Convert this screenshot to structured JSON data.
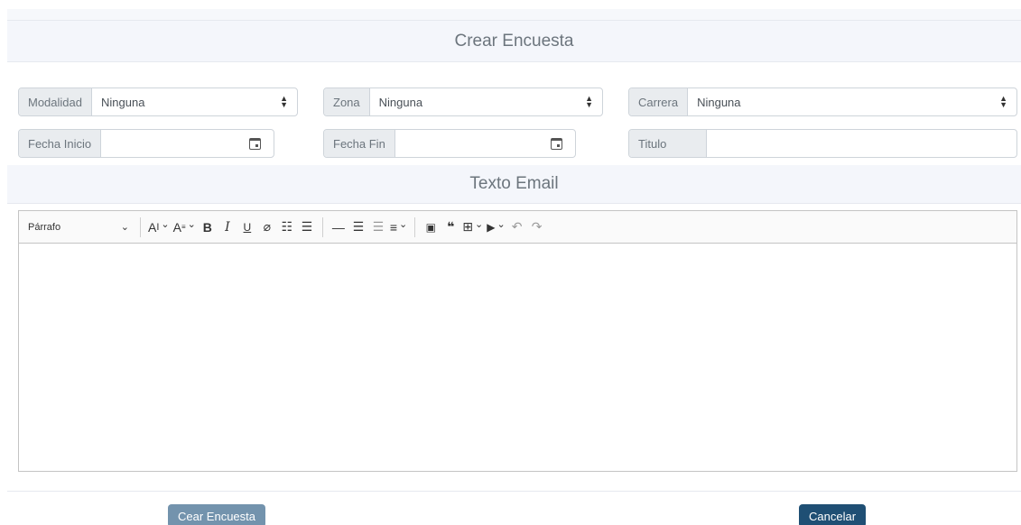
{
  "form": {
    "title": "Crear Encuesta",
    "email_title": "Texto Email",
    "filters": {
      "modalidad": {
        "label": "Modalidad",
        "value": "Ninguna"
      },
      "zona": {
        "label": "Zona",
        "value": "Ninguna"
      },
      "carrera": {
        "label": "Carrera",
        "value": "Ninguna"
      }
    },
    "dates": {
      "inicio": {
        "label": "Fecha Inicio",
        "value": ""
      },
      "fin": {
        "label": "Fecha Fin",
        "value": ""
      }
    },
    "titulo": {
      "label": "Titulo",
      "value": ""
    }
  },
  "editor": {
    "heading_select": "Párrafo",
    "icons": [
      "font-size-icon",
      "font-family-icon",
      "bold-icon",
      "italic-icon",
      "underline-icon",
      "link-icon",
      "bulleted-list-icon",
      "numbered-list-icon",
      "horizontal-line-icon",
      "indent-icon",
      "outdent-icon",
      "alignment-icon",
      "image-icon",
      "blockquote-icon",
      "table-icon",
      "media-icon",
      "undo-icon",
      "redo-icon"
    ],
    "content": ""
  },
  "actions": {
    "create_label": "Cear Encuesta",
    "cancel_label": "Cancelar"
  },
  "colors": {
    "create_button": "#7393ad",
    "cancel_button": "#1f4f74",
    "header_bg": "#f4f6fb"
  }
}
